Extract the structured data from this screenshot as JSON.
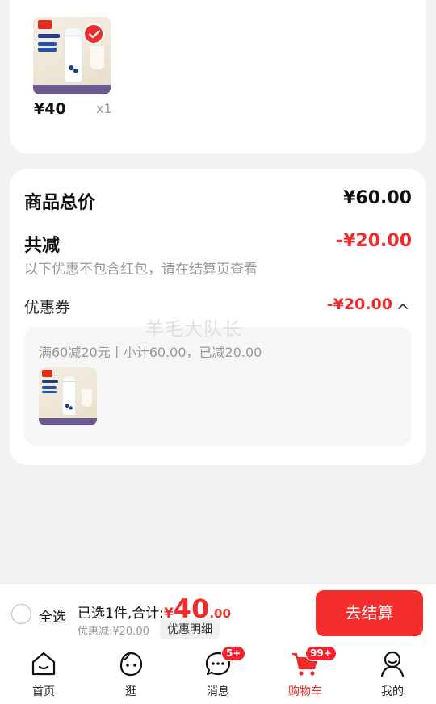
{
  "cart_item": {
    "price": "¥40",
    "quantity": "x1",
    "selected": true
  },
  "summary": {
    "total_label": "商品总价",
    "total_value": "¥60.00",
    "reduction_label": "共减",
    "reduction_value": "-¥20.00",
    "reduction_note": "以下优惠不包含红包，请在结算页查看",
    "coupon_label": "优惠券",
    "coupon_value": "-¥20.00",
    "coupon_detail": "满60减20元丨小计60.00，已减20.00"
  },
  "watermark": "羊毛大队长",
  "footer": {
    "select_all": "全选",
    "selected_total_prefix": "已选1件,合计:",
    "currency": "¥",
    "total_int": "40",
    "total_dec": ".00",
    "discount": "优惠减:¥20.00",
    "detail_button": "优惠明细",
    "checkout_button": "去结算"
  },
  "tabs": [
    {
      "label": "首页",
      "icon": "home-icon",
      "badge": ""
    },
    {
      "label": "逛",
      "icon": "browse-icon",
      "badge": ""
    },
    {
      "label": "消息",
      "icon": "message-icon",
      "badge": "5+"
    },
    {
      "label": "购物车",
      "icon": "cart-icon",
      "badge": "99+",
      "active": true
    },
    {
      "label": "我的",
      "icon": "profile-icon",
      "badge": ""
    }
  ],
  "colors": {
    "accent": "#f02b2b",
    "background": "#f2f2f2",
    "card": "#ffffff"
  }
}
